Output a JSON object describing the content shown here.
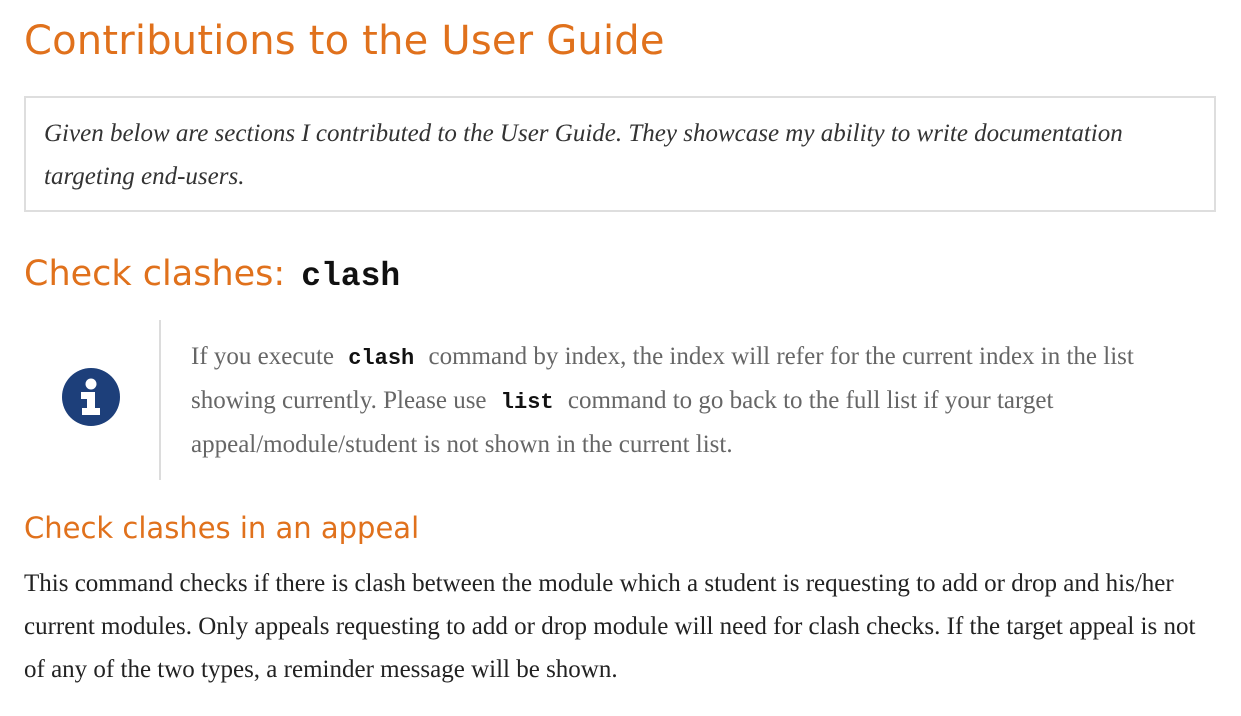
{
  "page_title": "Contributions to the User Guide",
  "intro": "Given below are sections I contributed to the User Guide. They showcase my ability to write documentation targeting end-users.",
  "section": {
    "title": "Check clashes:",
    "command": "clash"
  },
  "info_box": {
    "icon": "info-icon",
    "icon_color": "#1d3f7a",
    "text_1": "If you execute",
    "code_1": "clash",
    "text_2": "command by index, the index will refer for the current index in the list showing currently. Please use",
    "code_2": "list",
    "text_3": "command to go back to the full list if your target appeal/module/student is not shown in the current list."
  },
  "subsection": {
    "title": "Check clashes in an appeal",
    "body": "This command checks if there is clash between the module which a student is requesting to add or drop and his/her current modules. Only appeals requesting to add or drop module will need for clash checks. If the target appeal is not of any of the two types, a reminder message will be shown."
  },
  "colors": {
    "heading": "#e0711c",
    "info_icon": "#1d3f7a"
  }
}
